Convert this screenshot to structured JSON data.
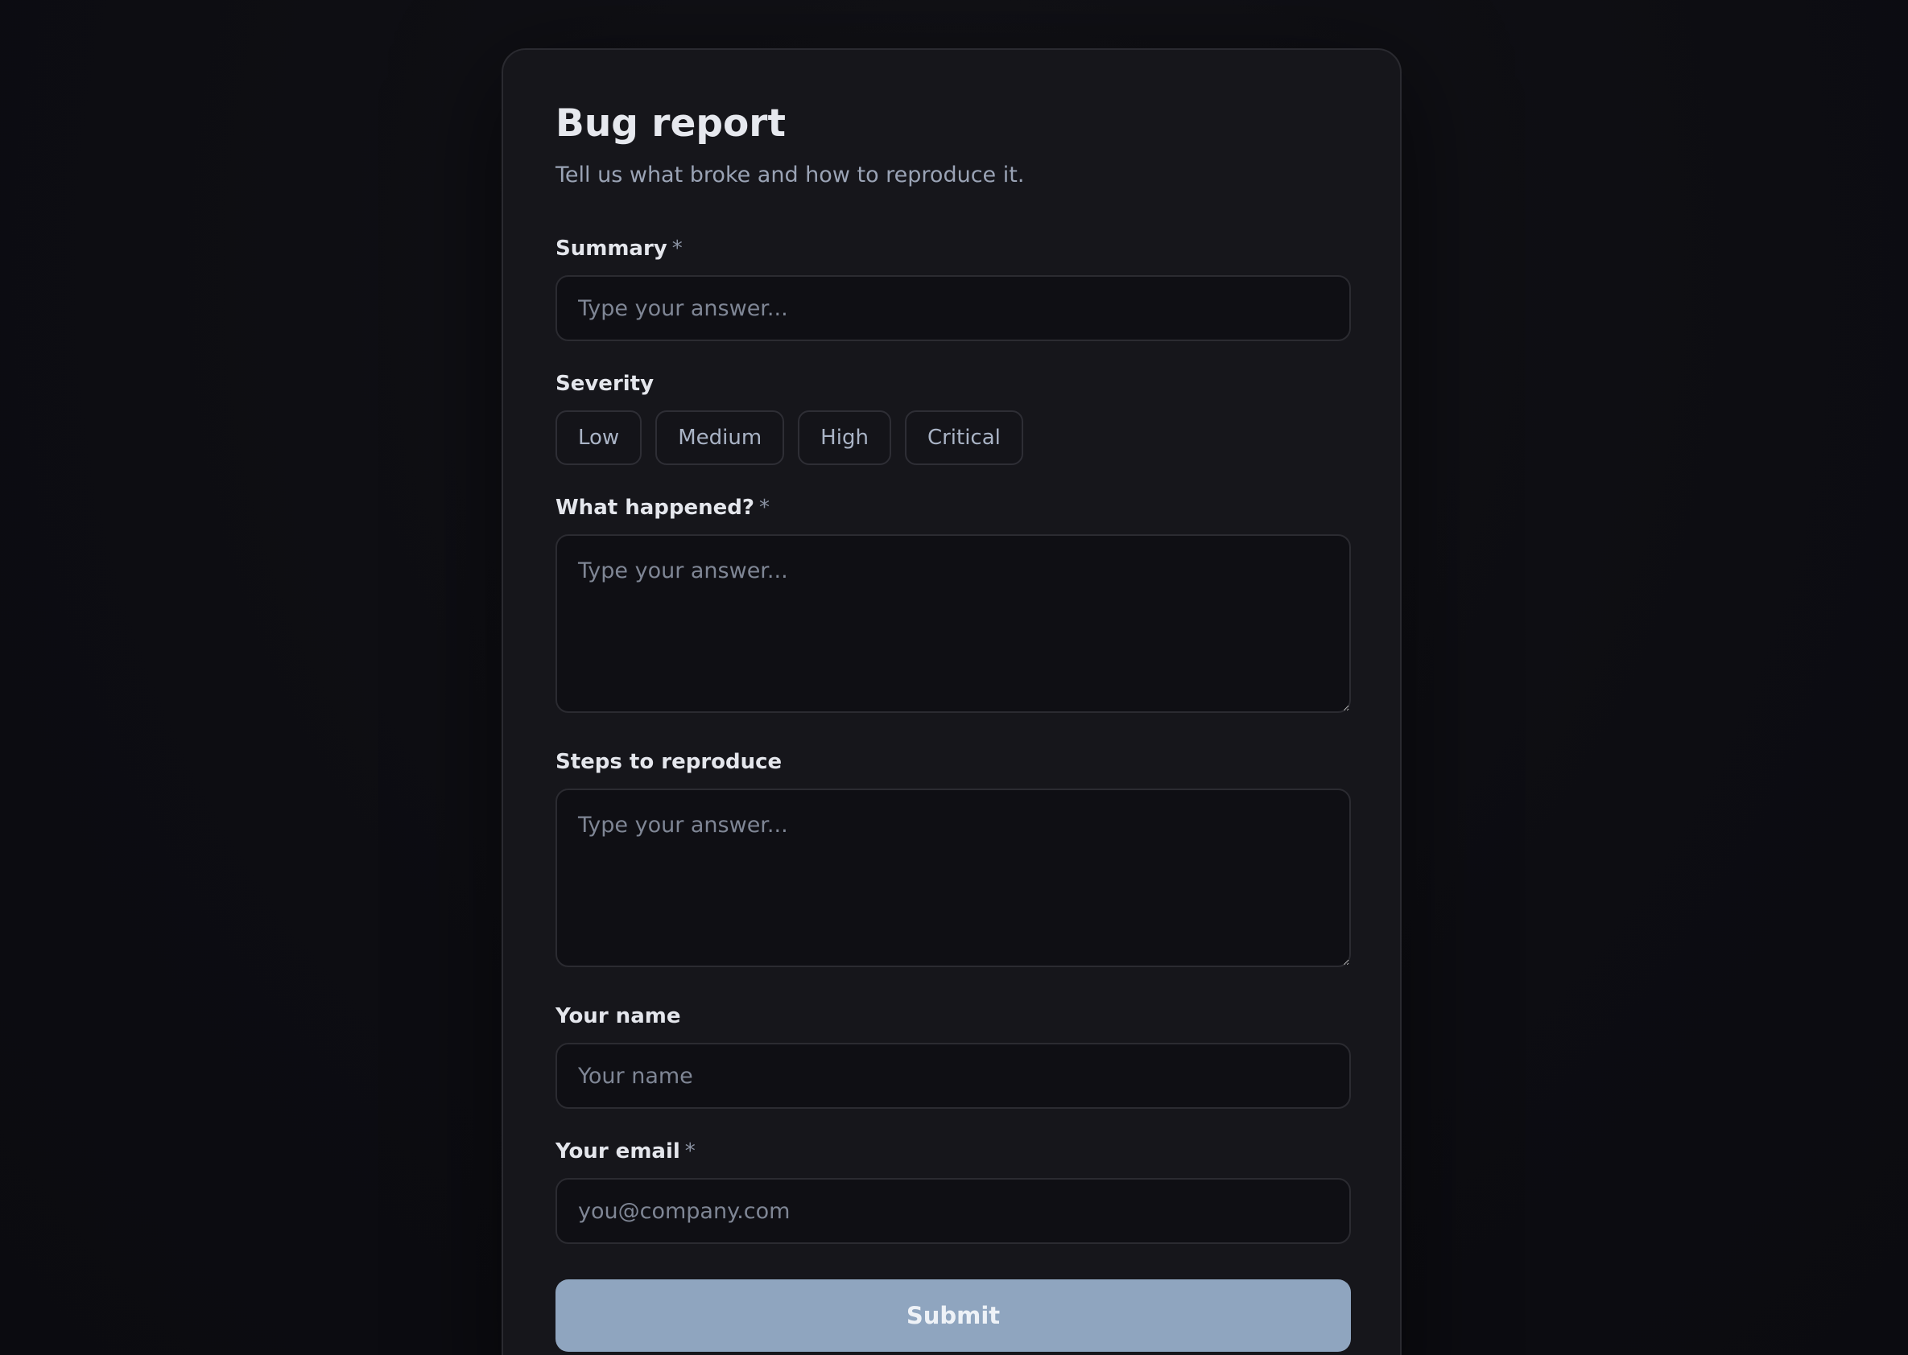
{
  "form": {
    "title": "Bug report",
    "subtitle": "Tell us what broke and how to reproduce it.",
    "required_marker": "*",
    "summary": {
      "label": "Summary",
      "placeholder": "Type your answer..."
    },
    "severity": {
      "label": "Severity",
      "options": [
        "Low",
        "Medium",
        "High",
        "Critical"
      ]
    },
    "what_happened": {
      "label": "What happened?",
      "placeholder": "Type your answer..."
    },
    "steps": {
      "label": "Steps to reproduce",
      "placeholder": "Type your answer..."
    },
    "name": {
      "label": "Your name",
      "placeholder": "Your name"
    },
    "email": {
      "label": "Your email",
      "placeholder": "you@company.com"
    },
    "submit_label": "Submit"
  },
  "colors": {
    "background": "#0d0d12",
    "card": "#16161b",
    "accent": "#8fa5bf"
  }
}
